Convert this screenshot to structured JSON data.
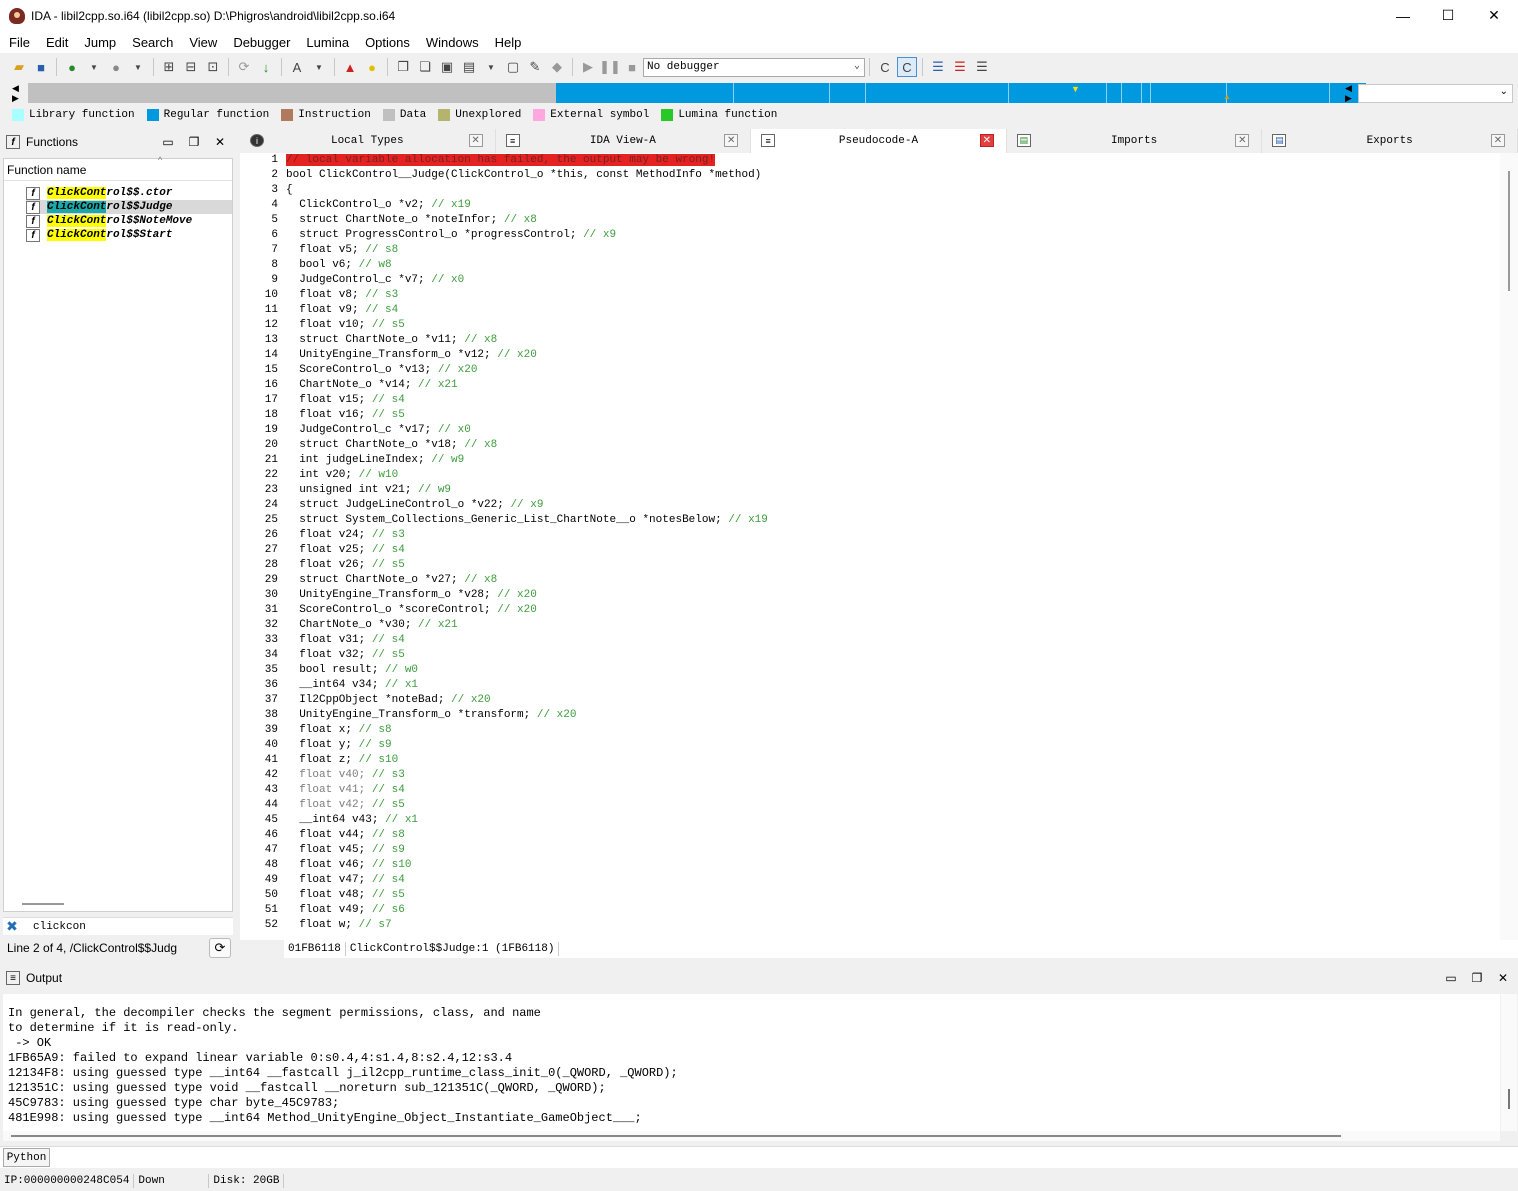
{
  "window": {
    "title": "IDA - libil2cpp.so.i64 (libil2cpp.so) D:\\Phigros\\android\\libil2cpp.so.i64",
    "controls": {
      "minimize": "—",
      "maximize": "☐",
      "close": "✕"
    }
  },
  "menu": [
    "File",
    "Edit",
    "Jump",
    "Search",
    "View",
    "Debugger",
    "Lumina",
    "Options",
    "Windows",
    "Help"
  ],
  "toolbar": {
    "debugger_select": "No debugger"
  },
  "legend": [
    {
      "label": "Library function",
      "color": "#a8ffff"
    },
    {
      "label": "Regular function",
      "color": "#0099e0"
    },
    {
      "label": "Instruction",
      "color": "#b07a5e"
    },
    {
      "label": "Data",
      "color": "#c0c0c0"
    },
    {
      "label": "Unexplored",
      "color": "#b4b46e"
    },
    {
      "label": "External symbol",
      "color": "#ffa8e0"
    },
    {
      "label": "Lumina function",
      "color": "#28c828"
    }
  ],
  "functions_panel": {
    "title": "Functions",
    "column_header": "Function name",
    "items": [
      {
        "match": "ClickCont",
        "rest": "rol$$.ctor"
      },
      {
        "match": "ClickCont",
        "rest": "rol$$Judge"
      },
      {
        "match": "ClickCont",
        "rest": "rol$$NoteMove"
      },
      {
        "match": "ClickCont",
        "rest": "rol$$Start"
      }
    ],
    "filter_value": "clickcon",
    "status": "Line 2 of 4, /ClickControl$$Judg"
  },
  "tabs": [
    {
      "label": "Local Types"
    },
    {
      "label": "IDA View-A"
    },
    {
      "label": "Pseudocode-A"
    },
    {
      "label": "Imports"
    },
    {
      "label": "Exports"
    }
  ],
  "code_lines": [
    {
      "n": "1",
      "code": "// local variable allocation has failed, the output may be wrong!",
      "cm": ""
    },
    {
      "n": "2",
      "code": "bool ClickControl__Judge(ClickControl_o *this, const MethodInfo *method)",
      "cm": ""
    },
    {
      "n": "3",
      "code": "{",
      "cm": ""
    },
    {
      "n": "4",
      "code": "  ClickControl_o *v2; ",
      "cm": "// x19"
    },
    {
      "n": "5",
      "code": "  struct ChartNote_o *noteInfor; ",
      "cm": "// x8"
    },
    {
      "n": "6",
      "code": "  struct ProgressControl_o *progressControl; ",
      "cm": "// x9"
    },
    {
      "n": "7",
      "code": "  float v5; ",
      "cm": "// s8"
    },
    {
      "n": "8",
      "code": "  bool v6; ",
      "cm": "// w8"
    },
    {
      "n": "9",
      "code": "  JudgeControl_c *v7; ",
      "cm": "// x0"
    },
    {
      "n": "10",
      "code": "  float v8; ",
      "cm": "// s3"
    },
    {
      "n": "11",
      "code": "  float v9; ",
      "cm": "// s4"
    },
    {
      "n": "12",
      "code": "  float v10; ",
      "cm": "// s5"
    },
    {
      "n": "13",
      "code": "  struct ChartNote_o *v11; ",
      "cm": "// x8"
    },
    {
      "n": "14",
      "code": "  UnityEngine_Transform_o *v12; ",
      "cm": "// x20"
    },
    {
      "n": "15",
      "code": "  ScoreControl_o *v13; ",
      "cm": "// x20"
    },
    {
      "n": "16",
      "code": "  ChartNote_o *v14; ",
      "cm": "// x21"
    },
    {
      "n": "17",
      "code": "  float v15; ",
      "cm": "// s4"
    },
    {
      "n": "18",
      "code": "  float v16; ",
      "cm": "// s5"
    },
    {
      "n": "19",
      "code": "  JudgeControl_c *v17; ",
      "cm": "// x0"
    },
    {
      "n": "20",
      "code": "  struct ChartNote_o *v18; ",
      "cm": "// x8"
    },
    {
      "n": "21",
      "code": "  int judgeLineIndex; ",
      "cm": "// w9"
    },
    {
      "n": "22",
      "code": "  int v20; ",
      "cm": "// w10"
    },
    {
      "n": "23",
      "code": "  unsigned int v21; ",
      "cm": "// w9"
    },
    {
      "n": "24",
      "code": "  struct JudgeLineControl_o *v22; ",
      "cm": "// x9"
    },
    {
      "n": "25",
      "code": "  struct System_Collections_Generic_List_ChartNote__o *notesBelow; ",
      "cm": "// x19"
    },
    {
      "n": "26",
      "code": "  float v24; ",
      "cm": "// s3"
    },
    {
      "n": "27",
      "code": "  float v25; ",
      "cm": "// s4"
    },
    {
      "n": "28",
      "code": "  float v26; ",
      "cm": "// s5"
    },
    {
      "n": "29",
      "code": "  struct ChartNote_o *v27; ",
      "cm": "// x8"
    },
    {
      "n": "30",
      "code": "  UnityEngine_Transform_o *v28; ",
      "cm": "// x20"
    },
    {
      "n": "31",
      "code": "  ScoreControl_o *scoreControl; ",
      "cm": "// x20"
    },
    {
      "n": "32",
      "code": "  ChartNote_o *v30; ",
      "cm": "// x21"
    },
    {
      "n": "33",
      "code": "  float v31; ",
      "cm": "// s4"
    },
    {
      "n": "34",
      "code": "  float v32; ",
      "cm": "// s5"
    },
    {
      "n": "35",
      "code": "  bool result; ",
      "cm": "// w0"
    },
    {
      "n": "36",
      "code": "  __int64 v34; ",
      "cm": "// x1"
    },
    {
      "n": "37",
      "code": "  Il2CppObject *noteBad; ",
      "cm": "// x20"
    },
    {
      "n": "38",
      "code": "  UnityEngine_Transform_o *transform; ",
      "cm": "// x20"
    },
    {
      "n": "39",
      "code": "  float x; ",
      "cm": "// s8"
    },
    {
      "n": "40",
      "code": "  float y; ",
      "cm": "// s9"
    },
    {
      "n": "41",
      "code": "  float z; ",
      "cm": "// s10"
    },
    {
      "n": "42",
      "code": "  float v40; ",
      "cm": "// s3"
    },
    {
      "n": "43",
      "code": "  float v41; ",
      "cm": "// s4"
    },
    {
      "n": "44",
      "code": "  float v42; ",
      "cm": "// s5"
    },
    {
      "n": "45",
      "code": "  __int64 v43; ",
      "cm": "// x1"
    },
    {
      "n": "46",
      "code": "  float v44; ",
      "cm": "// s8"
    },
    {
      "n": "47",
      "code": "  float v45; ",
      "cm": "// s9"
    },
    {
      "n": "48",
      "code": "  float v46; ",
      "cm": "// s10"
    },
    {
      "n": "49",
      "code": "  float v47; ",
      "cm": "// s4"
    },
    {
      "n": "50",
      "code": "  float v48; ",
      "cm": "// s5"
    },
    {
      "n": "51",
      "code": "  float v49; ",
      "cm": "// s6"
    },
    {
      "n": "52",
      "code": "  float w; ",
      "cm": "// s7"
    }
  ],
  "code_status": {
    "address": "01FB6118",
    "location": "ClickControl$$Judge:1 (1FB6118)"
  },
  "output_panel": {
    "title": "Output",
    "lines": [
      "In general, the decompiler checks the segment permissions, class, and name",
      "to determine if it is read-only.",
      " -> OK",
      "1FB65A9: failed to expand linear variable 0:s0.4,4:s1.4,8:s2.4,12:s3.4",
      "12134F8: using guessed type __int64 __fastcall j_il2cpp_runtime_class_init_0(_QWORD, _QWORD);",
      "121351C: using guessed type void __fastcall __noreturn sub_121351C(_QWORD, _QWORD);",
      "45C9783: using guessed type char byte_45C9783;",
      "481E998: using guessed type __int64 Method_UnityEngine_Object_Instantiate_GameObject___;"
    ]
  },
  "python_button": "Python",
  "statusbar": {
    "ip": "IP:000000000248C054",
    "direction": "Down",
    "disk": "Disk: 20GB"
  }
}
